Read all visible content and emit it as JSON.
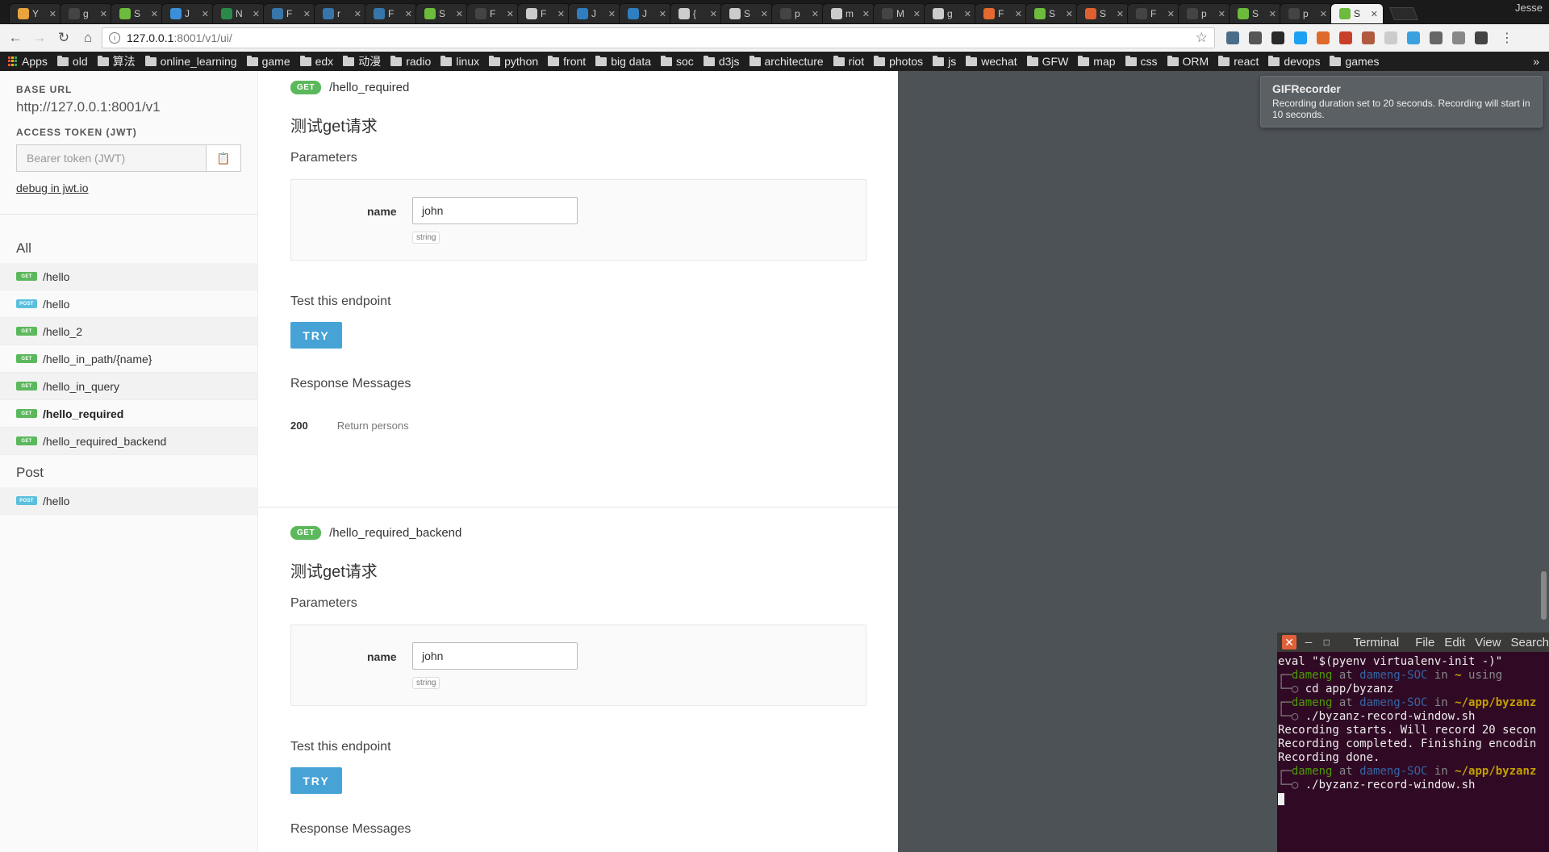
{
  "browser": {
    "tabs": [
      {
        "label": "Y",
        "color": "#e8a33c"
      },
      {
        "label": "g",
        "color": "#444444"
      },
      {
        "label": "S",
        "color": "#6cbb3c"
      },
      {
        "label": "J",
        "color": "#3b8fd8"
      },
      {
        "label": "N",
        "color": "#2a8a4a"
      },
      {
        "label": "F",
        "color": "#3776ab"
      },
      {
        "label": "r",
        "color": "#3776ab"
      },
      {
        "label": "F",
        "color": "#3776ab"
      },
      {
        "label": "S",
        "color": "#6cbb3c"
      },
      {
        "label": "F",
        "color": "#444444"
      },
      {
        "label": "F",
        "color": "#cccccc"
      },
      {
        "label": "J",
        "color": "#2f7fc0"
      },
      {
        "label": "J",
        "color": "#2f7fc0"
      },
      {
        "label": "{",
        "color": "#cccccc"
      },
      {
        "label": "S",
        "color": "#cccccc"
      },
      {
        "label": "p",
        "color": "#444444"
      },
      {
        "label": "m",
        "color": "#cccccc"
      },
      {
        "label": "M",
        "color": "#444444"
      },
      {
        "label": "g",
        "color": "#cccccc"
      },
      {
        "label": "F",
        "color": "#e46a2f"
      },
      {
        "label": "S",
        "color": "#6cbb3c"
      },
      {
        "label": "S",
        "color": "#e06030"
      },
      {
        "label": "F",
        "color": "#444444"
      },
      {
        "label": "p",
        "color": "#444444"
      },
      {
        "label": "S",
        "color": "#6cbb3c"
      },
      {
        "label": "p",
        "color": "#444444"
      },
      {
        "label": "S",
        "color": "#6cbb3c",
        "active": true
      }
    ],
    "profile_name": "Jesse",
    "url_host": "127.0.0.1",
    "url_rest": ":8001/v1/ui/",
    "bookmarks": {
      "apps_label": "Apps",
      "folders": [
        "old",
        "算法",
        "online_learning",
        "game",
        "edx",
        "动漫",
        "radio",
        "linux",
        "python",
        "front",
        "big data",
        "soc",
        "d3js",
        "architecture",
        "riot",
        "photos",
        "js",
        "wechat",
        "GFW",
        "map",
        "css",
        "ORM",
        "react",
        "devops",
        "games"
      ],
      "more": "»"
    },
    "extension_colors": [
      "#4a6e8a",
      "#555555",
      "#2a2a2a",
      "#1da1f2",
      "#e06a2a",
      "#c8402a",
      "#b05a40",
      "#cccccc",
      "#3aa0e0",
      "#666666",
      "#888888",
      "#444444"
    ]
  },
  "sidebar": {
    "base_url_label": "BASE URL",
    "base_url": "http://127.0.0.1:8001/v1",
    "token_label": "ACCESS TOKEN (JWT)",
    "token_placeholder": "Bearer token (JWT)",
    "debug_link": "debug in jwt.io",
    "groups": [
      {
        "name": "All",
        "items": [
          {
            "method": "GET",
            "path": "/hello"
          },
          {
            "method": "POST",
            "path": "/hello"
          },
          {
            "method": "GET",
            "path": "/hello_2"
          },
          {
            "method": "GET",
            "path": "/hello_in_path/{name}"
          },
          {
            "method": "GET",
            "path": "/hello_in_query"
          },
          {
            "method": "GET",
            "path": "/hello_required",
            "active": true
          },
          {
            "method": "GET",
            "path": "/hello_required_backend"
          }
        ]
      },
      {
        "name": "Post",
        "items": [
          {
            "method": "POST",
            "path": "/hello"
          }
        ]
      }
    ]
  },
  "endpoints": [
    {
      "method": "GET",
      "path": "/hello_required",
      "description": "测试get请求",
      "params_title": "Parameters",
      "param_name": "name",
      "param_value": "john",
      "param_type": "string",
      "test_title": "Test this endpoint",
      "try_label": "TRY",
      "responses_title": "Response Messages",
      "response_code": "200",
      "response_message": "Return persons"
    },
    {
      "method": "GET",
      "path": "/hello_required_backend",
      "description": "测试get请求",
      "params_title": "Parameters",
      "param_name": "name",
      "param_value": "john",
      "param_type": "string",
      "test_title": "Test this endpoint",
      "try_label": "TRY",
      "responses_title": "Response Messages"
    }
  ],
  "notification": {
    "title": "GIFRecorder",
    "body": "Recording duration set to 20 seconds. Recording will start in 10 seconds."
  },
  "terminal": {
    "title": "Terminal",
    "menu": [
      "File",
      "Edit",
      "View",
      "Search"
    ],
    "lines": [
      {
        "type": "plain",
        "text": "eval \"$(pyenv virtualenv-init -)\""
      },
      {
        "type": "prompt",
        "user": "dameng",
        "host": "dameng-SOC",
        "dir": "~",
        "extra": " using"
      },
      {
        "type": "cmd",
        "text": "cd app/byzanz"
      },
      {
        "type": "prompt",
        "user": "dameng",
        "host": "dameng-SOC",
        "dir": "~/app/byzanz",
        "extra": ""
      },
      {
        "type": "cmd",
        "text": "./byzanz-record-window.sh"
      },
      {
        "type": "plain",
        "text": "Recording starts. Will record 20 secon"
      },
      {
        "type": "plain",
        "text": "Recording completed. Finishing encodin"
      },
      {
        "type": "plain",
        "text": "Recording done."
      },
      {
        "type": "prompt",
        "user": "dameng",
        "host": "dameng-SOC",
        "dir": "~/app/byzanz",
        "extra": ""
      },
      {
        "type": "cmd",
        "text": "./byzanz-record-window.sh"
      }
    ]
  }
}
